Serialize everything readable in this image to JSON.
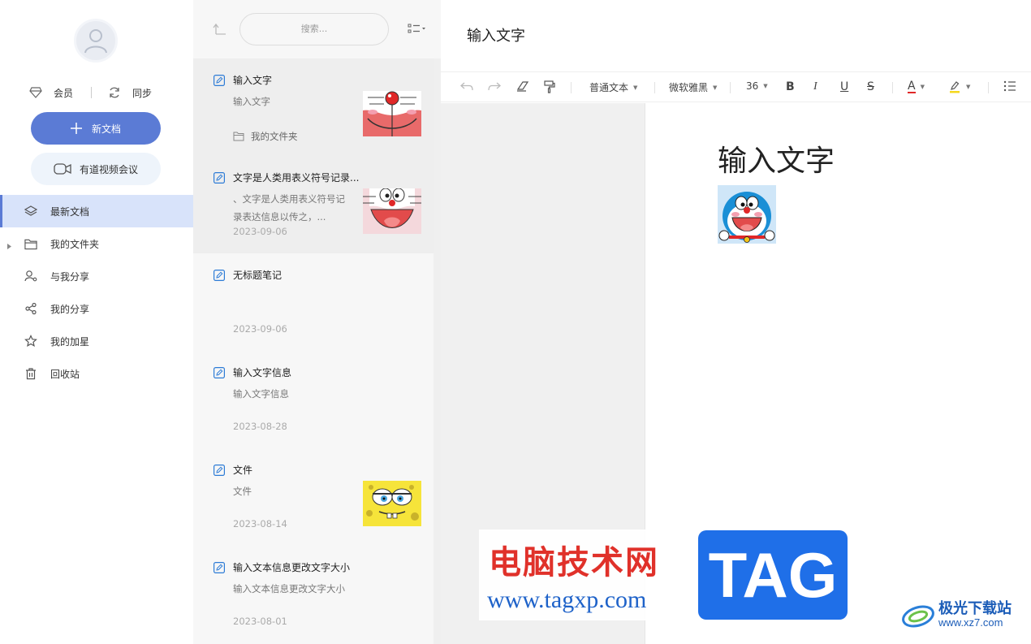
{
  "sidebar": {
    "member_label": "会员",
    "sync_label": "同步",
    "new_doc_label": "新文档",
    "meeting_label": "有道视频会议",
    "nav": [
      {
        "label": "最新文档",
        "icon": "layers-icon",
        "active": true
      },
      {
        "label": "我的文件夹",
        "icon": "folder-icon"
      },
      {
        "label": "与我分享",
        "icon": "shared-with-me-icon"
      },
      {
        "label": "我的分享",
        "icon": "share-icon"
      },
      {
        "label": "我的加星",
        "icon": "star-icon"
      },
      {
        "label": "回收站",
        "icon": "trash-icon"
      }
    ]
  },
  "list": {
    "search_placeholder": "搜索...",
    "notes": [
      {
        "title": "输入文字",
        "snippet": "输入文字",
        "folder": "我的文件夹",
        "thumb": "doraemon-face-closeup"
      },
      {
        "title": "文字是人类用表义符号记录...",
        "snippet": "、文字是人类用表义符号记录表达信息以传之，...",
        "date": "2023-09-06",
        "thumb": "doraemon-face"
      },
      {
        "title": "无标题笔记",
        "snippet": "",
        "date": "2023-09-06"
      },
      {
        "title": "输入文字信息",
        "snippet": "输入文字信息",
        "date": "2023-08-28"
      },
      {
        "title": "文件",
        "snippet": "文件",
        "date": "2023-08-14",
        "thumb": "spongebob"
      },
      {
        "title": "输入文本信息更改文字大小",
        "snippet": "输入文本信息更改文字大小",
        "date": "2023-08-01"
      }
    ]
  },
  "editor": {
    "title": "输入文字",
    "toolbar": {
      "paragraph_style": "普通文本",
      "font": "微软雅黑",
      "font_size": "36",
      "bold": "B",
      "italic": "I",
      "underline": "U",
      "strike": "S",
      "font_color": "A"
    },
    "heading": "输入文字",
    "image": "doraemon-portrait"
  },
  "watermark": {
    "site_cn": "电脑技术网",
    "site_url": "www.tagxp.com",
    "tag": "TAG",
    "logo_cn": "极光下载站",
    "logo_url": "www.xz7.com"
  },
  "colors": {
    "accent": "#5b7bd5",
    "nav_active_bg": "#d8e3fa",
    "watermark_red": "#e0312a",
    "watermark_blue": "#1f6fe8"
  }
}
